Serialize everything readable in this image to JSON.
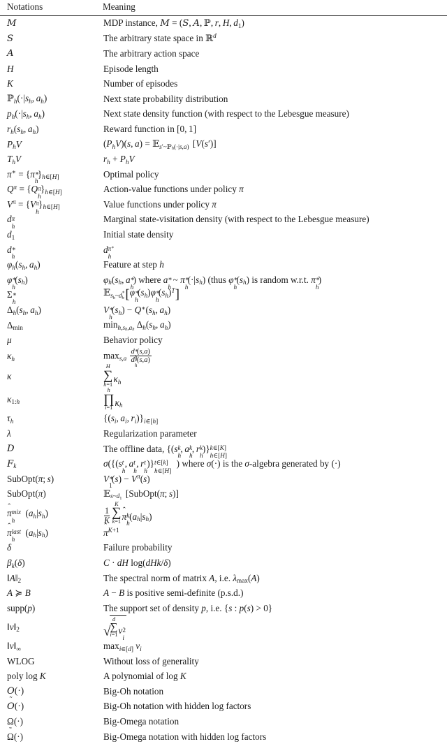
{
  "document": {
    "type": "notation-table",
    "background_color": "#ffffff",
    "text_color": "#1a1a1a",
    "rule_color": "#333333"
  },
  "table": {
    "columns": [
      {
        "key": "notation",
        "header": "Notations"
      },
      {
        "key": "meaning",
        "header": "Meaning"
      }
    ],
    "rows": [
      {
        "notation": "M",
        "meaning": "MDP instance, M = (S, A, P, r, H, d_1)"
      },
      {
        "notation": "S",
        "meaning": "The arbitrary state space in R^d"
      },
      {
        "notation": "A",
        "meaning": "The arbitrary action space"
      },
      {
        "notation": "H",
        "meaning": "Episode length"
      },
      {
        "notation": "K",
        "meaning": "Number of episodes"
      },
      {
        "notation": "P_h(·|s_h, a_h)",
        "meaning": "Next state probability distribution"
      },
      {
        "notation": "p_h(·|s_h, a_h)",
        "meaning": "Next state density function (with respect to the Lebesgue measure)"
      },
      {
        "notation": "r_h(s_h, a_h)",
        "meaning": "Reward function in [0, 1]"
      },
      {
        "notation": "P_h V",
        "meaning": "(P_h V)(s, a) = E_{s'~P_h(·|s,a)} [V(s')]"
      },
      {
        "notation": "T_h V",
        "meaning": "r_h + P_h V"
      },
      {
        "notation": "pi* = {pi*_h}_{h in [H]}",
        "meaning": "Optimal policy"
      },
      {
        "notation": "Q^pi = {Q^pi_h}_{h in [H]}",
        "meaning": "Action-value functions under policy pi"
      },
      {
        "notation": "V^pi = {V^pi_h}_{h in [H]}",
        "meaning": "Value functions under policy pi"
      },
      {
        "notation": "d^pi_h",
        "meaning": "Marginal state-visitation density (with respect to the Lebesgue measure)"
      },
      {
        "notation": "d_1",
        "meaning": "Initial state density"
      },
      {
        "notation": "d*_h",
        "meaning": "d^{pi*}_h"
      },
      {
        "notation": "phi_h(s_h, a_h)",
        "meaning": "Feature at step h"
      },
      {
        "notation": "phi*_h(s_h)",
        "meaning": "phi_h(s_h, a*_h) where a*_h ~ pi*_h(·|s_h) (thus phi*_h(s_h) is random w.r.t. pi*_h)"
      },
      {
        "notation": "Sigma*_h",
        "meaning": "E_{s_h ~ d*_h} [ phi*_h(s_h) phi*_h(s_h)^T ]"
      },
      {
        "notation": "Delta_h(s_h, a_h)",
        "meaning": "V*_h(s_h) - Q*(s_h, a_h)"
      },
      {
        "notation": "Delta_min",
        "meaning": "min_{h, s_h, a_h} Delta_h(s_h, a_h)"
      },
      {
        "notation": "mu",
        "meaning": "Behavior policy"
      },
      {
        "notation": "kappa_h",
        "meaning": "max_{s,a} d*_h(s,a) / d^mu_h(s,a)"
      },
      {
        "notation": "kappa",
        "meaning": "sum_{h=1}^{H} kappa_h"
      },
      {
        "notation": "kappa_{1:h}",
        "meaning": "prod_{i=1}^{h} kappa_h"
      },
      {
        "notation": "tau_h",
        "meaning": "{(s_i, a_i, r_i)}_{i in [h]}"
      },
      {
        "notation": "lambda",
        "meaning": "Regularization parameter"
      },
      {
        "notation": "D",
        "meaning": "The offline data, {(s^k_h, a^k_h, r^k_h)}^{k in [K]}_{h in [H]}"
      },
      {
        "notation": "F_k",
        "meaning": "sigma({(s^t_h, a^t_h, r^t_h)}^{t in [k]}_{h in [H]}) where sigma(·) is the sigma-algebra generated by (·)"
      },
      {
        "notation": "SubOpt(pi; s)",
        "meaning": "V*_1(s) - V^pi(s)"
      },
      {
        "notation": "SubOpt(pi)",
        "meaning": "E_{s ~ d_1} [SubOpt(pi; s)]"
      },
      {
        "notation": "hat-pi^mix_h(a_h|s_h)",
        "meaning": "(1/K) sum_{k=1}^{K} hat-pi^k_h(a_h|s_h)"
      },
      {
        "notation": "hat-pi^last_h(a_h|s_h)",
        "meaning": "hat-pi^{K+1}"
      },
      {
        "notation": "delta",
        "meaning": "Failure probability"
      },
      {
        "notation": "beta_k(delta)",
        "meaning": "C · dH log(dHk/delta)"
      },
      {
        "notation": "||A||_2",
        "meaning": "The spectral norm of matrix A, i.e. lambda_max(A)"
      },
      {
        "notation": "A >= B",
        "meaning": "A - B is positive semi-definite (p.s.d.)"
      },
      {
        "notation": "supp(p)",
        "meaning": "The support set of density p, i.e. {s : p(s) > 0}"
      },
      {
        "notation": "||v||_2",
        "meaning": "sqrt( sum_{i=1}^{d} v_i^2 )"
      },
      {
        "notation": "||v||_inf",
        "meaning": "max_{i in [d]} v_i"
      },
      {
        "notation": "WLOG",
        "meaning": "Without loss of generality"
      },
      {
        "notation": "poly log K",
        "meaning": "A polynomial of log K"
      },
      {
        "notation": "O(·)",
        "meaning": "Big-Oh notation"
      },
      {
        "notation": "tilde-O(·)",
        "meaning": "Big-Oh notation with hidden log factors"
      },
      {
        "notation": "Omega(·)",
        "meaning": "Big-Omega notation"
      },
      {
        "notation": "tilde-Omega(·)",
        "meaning": "Big-Omega notation with hidden log factors"
      }
    ],
    "meaning_text": {
      "r1": "MDP instance,",
      "r2": "The arbitrary state space in",
      "r3": "The arbitrary action space",
      "r4": "Episode length",
      "r5": "Number of episodes",
      "r6": "Next state probability distribution",
      "r7": "Next state density function (with respect to the Lebesgue measure)",
      "r8": "Reward function in",
      "r11": "Optimal policy",
      "r12": "Action-value functions under policy",
      "r13": "Value functions under policy",
      "r14": "Marginal state-visitation density (with respect to the Lebesgue measure)",
      "r15": "Initial state density",
      "r17": "Feature at step",
      "r18a": "where",
      "r18b": "(thus",
      "r18c": "is random w.r.t.",
      "r22": "Behavior policy",
      "r27": "Regularization parameter",
      "r28": "The offline data,",
      "r29a": "where",
      "r29b": "is the",
      "r29c": "-algebra generated by",
      "r34": "Failure probability",
      "r36a": "The spectral norm of matrix",
      "r36b": ", i.e.",
      "r37": "is positive semi-definite (p.s.d.)",
      "r38a": "The support set of density",
      "r38b": ", i.e.",
      "r41": "Without loss of generality",
      "r42a": "A polynomial of",
      "r43": "Big-Oh notation",
      "r44": "Big-Oh notation with hidden log factors",
      "r45": "Big-Omega notation",
      "r46": "Big-Omega notation with hidden log factors"
    }
  }
}
